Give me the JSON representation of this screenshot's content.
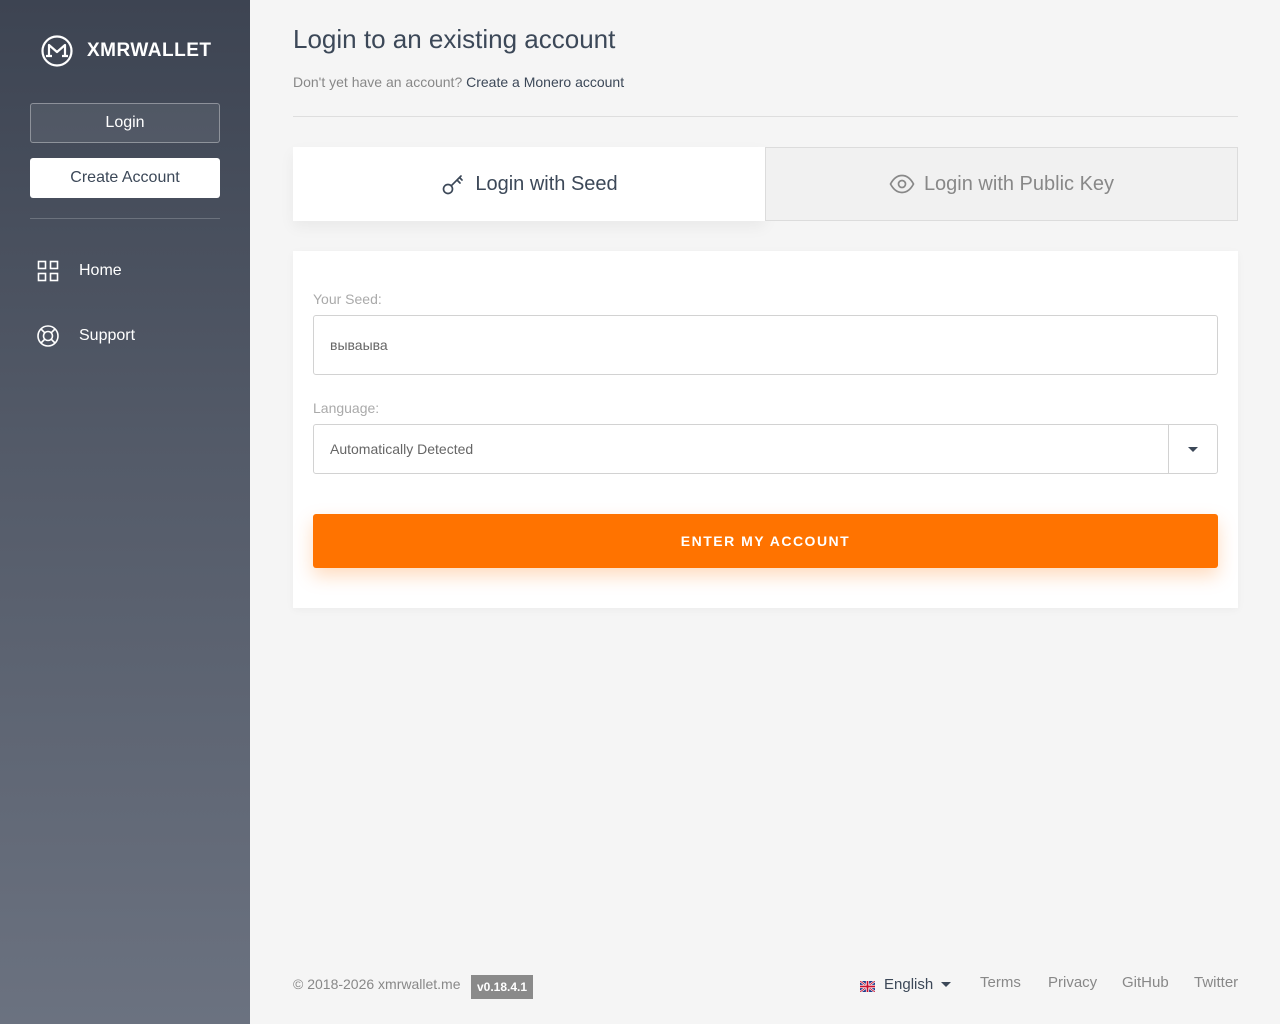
{
  "sidebar": {
    "brand": "XMRWALLET",
    "login_button": "Login",
    "create_button": "Create Account",
    "nav": [
      {
        "label": "Home",
        "icon": "grid-icon"
      },
      {
        "label": "Support",
        "icon": "lifebuoy-icon"
      }
    ]
  },
  "main": {
    "title": "Login to an existing account",
    "subtitle_prefix": "Don't yet have an account?",
    "subtitle_link": "Create a Monero account",
    "tabs": [
      {
        "label": "Login with Seed",
        "icon": "key-icon",
        "active": true
      },
      {
        "label": "Login with Public Key",
        "icon": "eye-icon",
        "active": false
      }
    ],
    "form": {
      "seed_label": "Your Seed:",
      "seed_value": "вываыва",
      "language_label": "Language:",
      "language_value": "Automatically Detected",
      "submit_label": "ENTER MY ACCOUNT"
    }
  },
  "footer": {
    "copyright": "© 2018-2026 xmrwallet.me",
    "version": "v0.18.4.1",
    "language": "English",
    "links": [
      "Terms",
      "Privacy",
      "GitHub",
      "Twitter"
    ]
  },
  "colors": {
    "accent": "#ff7300",
    "sidebar_top": "#3d4452",
    "sidebar_bottom": "#6b7280",
    "text": "#3c4858"
  }
}
